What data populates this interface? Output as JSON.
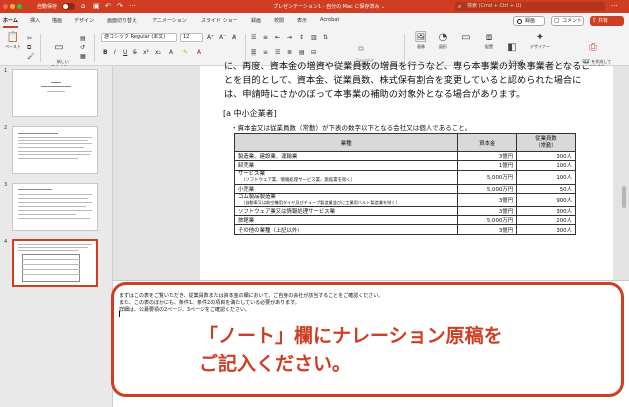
{
  "titlebar": {
    "autosave_label": "自動保存",
    "doc_title": "プレゼンテーション1 - 自分の Mac に保存済み ⌄",
    "search_placeholder": "検索 (Cmd + Ctrl + U)",
    "more": "···"
  },
  "tabs": [
    "ホーム",
    "挿入",
    "描画",
    "デザイン",
    "画面切り替え",
    "アニメーション",
    "スライド ショー",
    "録画",
    "校閲",
    "表示",
    "Acrobat"
  ],
  "actions": {
    "record": "録画",
    "comment": "コメント",
    "share": "共有"
  },
  "toolbar": {
    "paste": "ペースト",
    "new_slide": "新しい\nスライド",
    "font_name": "游ゴシック Regular (本文)",
    "font_size": "12",
    "smartart": "SmartArt\nに変換",
    "picture": "画像",
    "shape": "図形",
    "arrange": "配置",
    "quick_styles": "クイック\nスタイル",
    "designer": "デザイナー",
    "pdf": "PDF を作成して\nリンクを共有"
  },
  "thumbnails": [
    {
      "number": "1"
    },
    {
      "number": "2"
    },
    {
      "number": "3"
    },
    {
      "number": "4",
      "selected": true
    }
  ],
  "slide": {
    "lines": [
      "に、再度、資本金の増資や従業員数の増員を行うなど、専ら本事業の対象事業者となるこ",
      "とを目的として、資本金、従業員数、株式保有割合を変更していると認められた場合に",
      "は、申請時にさかのぼって本事業の補助の対象外となる場合があります。"
    ],
    "section": "[a 中小企業者]",
    "bullet": "・資本金又は従業員数（常勤）が下表の数字以下となる会社又は個人であること。",
    "table": {
      "headers": [
        "業種",
        "資本金",
        "従業員数\n（常勤）"
      ],
      "rows": [
        {
          "industry": "製造業、建設業、運輸業",
          "sub": "",
          "capital": "3億円",
          "employees": "300人"
        },
        {
          "industry": "卸売業",
          "sub": "",
          "capital": "1億円",
          "employees": "100人"
        },
        {
          "industry": "サービス業",
          "sub": "（ソフトウェア業、情報処理サービス業、旅館業を除く）",
          "capital": "5,000万円",
          "employees": "100人"
        },
        {
          "industry": "小売業",
          "sub": "",
          "capital": "5,000万円",
          "employees": "50人"
        },
        {
          "industry": "ゴム製品製造業",
          "sub": "（自動車又は航空機用タイヤ及びチューブ製造業並びに工業用ベルト製造業を除く）",
          "capital": "3億円",
          "employees": "900人"
        },
        {
          "industry": "ソフトウェア業又は情報処理サービス業",
          "sub": "",
          "capital": "3億円",
          "employees": "300人"
        },
        {
          "industry": "旅館業",
          "sub": "",
          "capital": "5,000万円",
          "employees": "200人"
        },
        {
          "industry": "その他の業種（上記以外）",
          "sub": "",
          "capital": "3億円",
          "employees": "300人"
        }
      ]
    }
  },
  "notes": [
    "まずはこの表をご覧いただき、従業員数または資本金の欄において、ご自身の会社が該当することをご確認ください。",
    "また、この表のほかにも、条件1、条件2の項目を満たしている必要があります。",
    "詳細は、公募要領の2ページ、3ページをご確認ください。"
  ],
  "callout": {
    "line1": "「ノート」欄にナレーション原稿を",
    "line2": "ご記入ください。"
  },
  "colors": {
    "accent": "#cf3e22"
  }
}
